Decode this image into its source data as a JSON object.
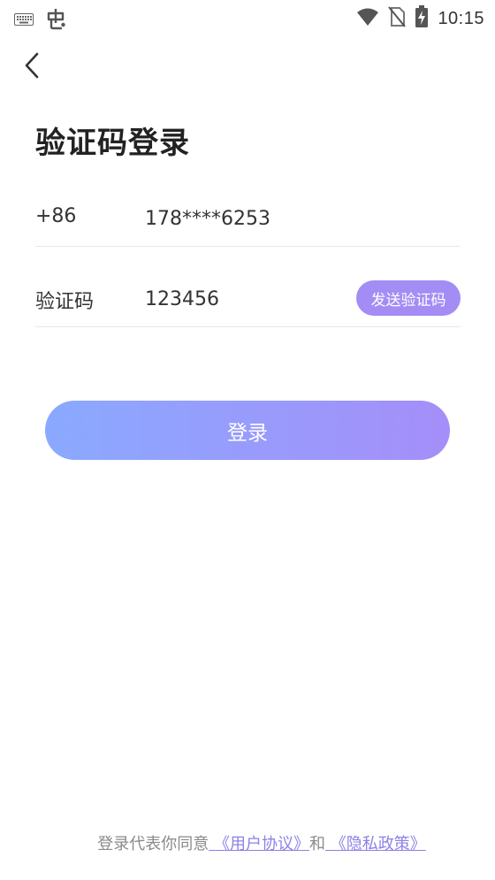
{
  "status_bar": {
    "time": "10:15",
    "left_icons": [
      "keyboard-icon",
      "bug-icon"
    ],
    "right_icons": [
      "wifi-icon",
      "no-sim-icon",
      "battery-charging-icon"
    ]
  },
  "header": {
    "back_icon": "chevron-left-icon"
  },
  "page": {
    "title": "验证码登录"
  },
  "form": {
    "phone": {
      "country_code": "+86",
      "number": "178****6253"
    },
    "code": {
      "label": "验证码",
      "value": "123456",
      "send_button_label": "发送验证码"
    },
    "login_button_label": "登录"
  },
  "footer": {
    "agreement_prefix": "登录代表你同意",
    "user_agreement_link": " 《用户协议》",
    "and_text": "和",
    "privacy_policy_link": " 《隐私政策》 "
  },
  "colors": {
    "accent": "#a38df5",
    "gradient_start": "#8aa9ff",
    "gradient_end": "#a58ef9",
    "link": "#8b82e6"
  }
}
